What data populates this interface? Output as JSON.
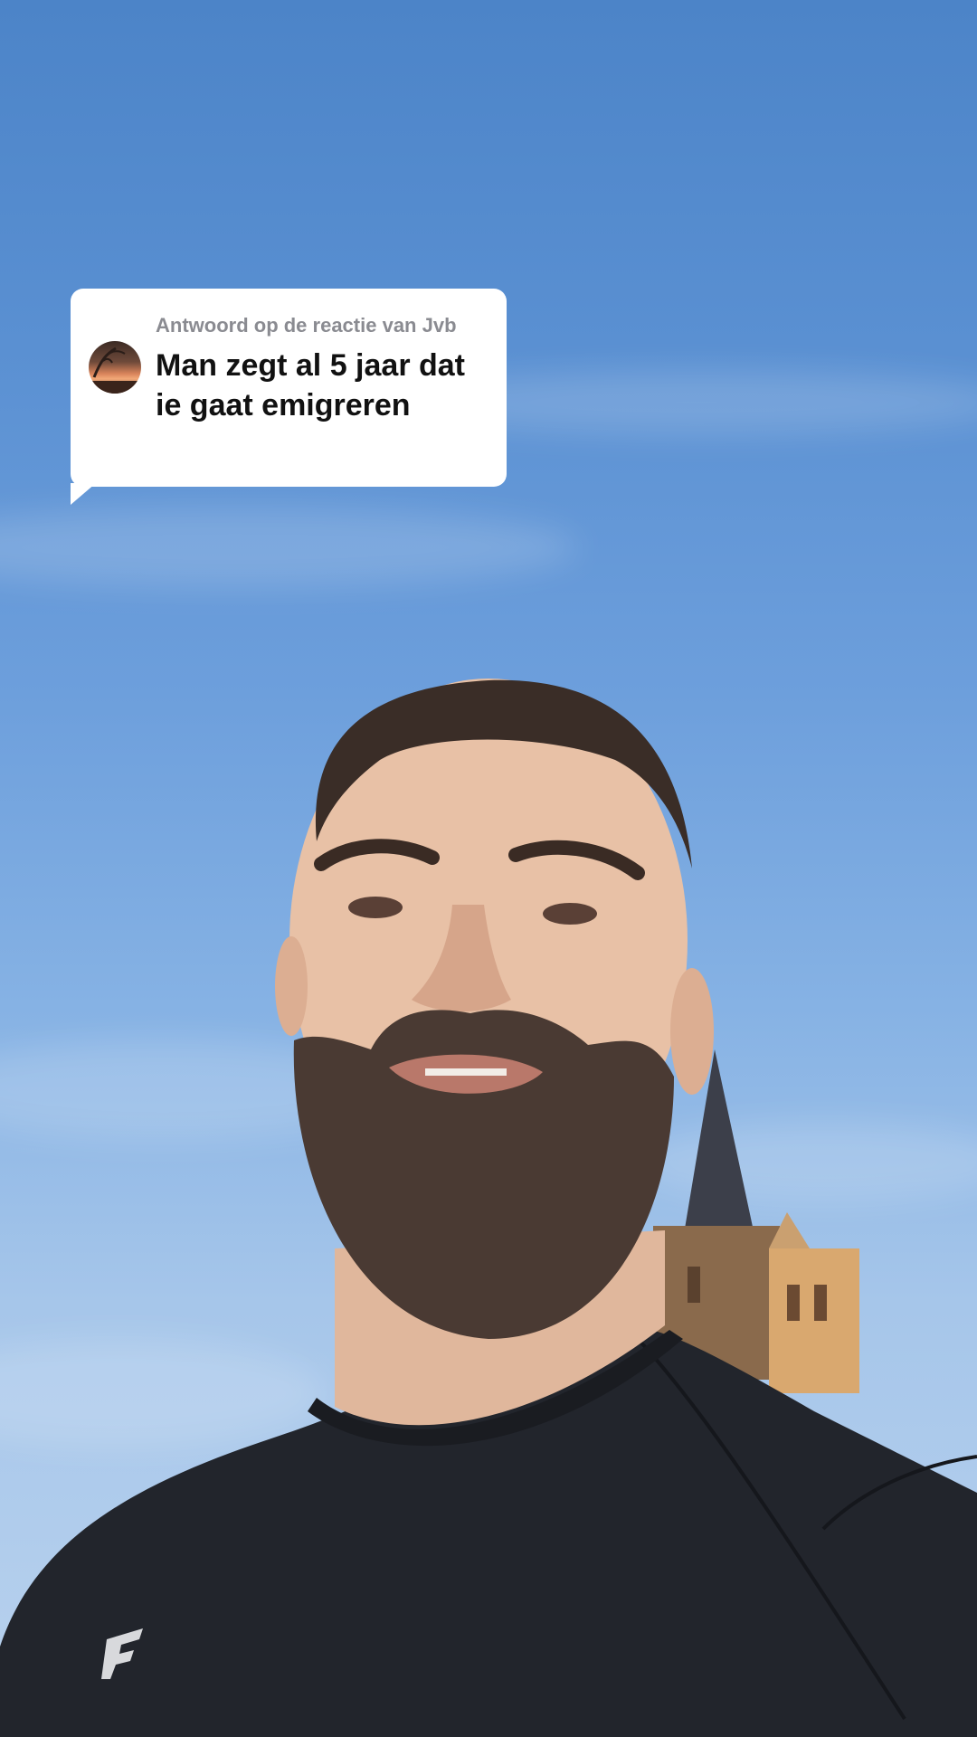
{
  "reply": {
    "prefix": "Antwoord op de reactie van",
    "username": "Jvb",
    "comment": "Man zegt al 5 jaar dat ie gaat emigreren"
  },
  "video": {
    "description": ""
  },
  "icons": {
    "avatar": "commenter-avatar-icon",
    "shirt_logo": "brand-logo-icon"
  }
}
